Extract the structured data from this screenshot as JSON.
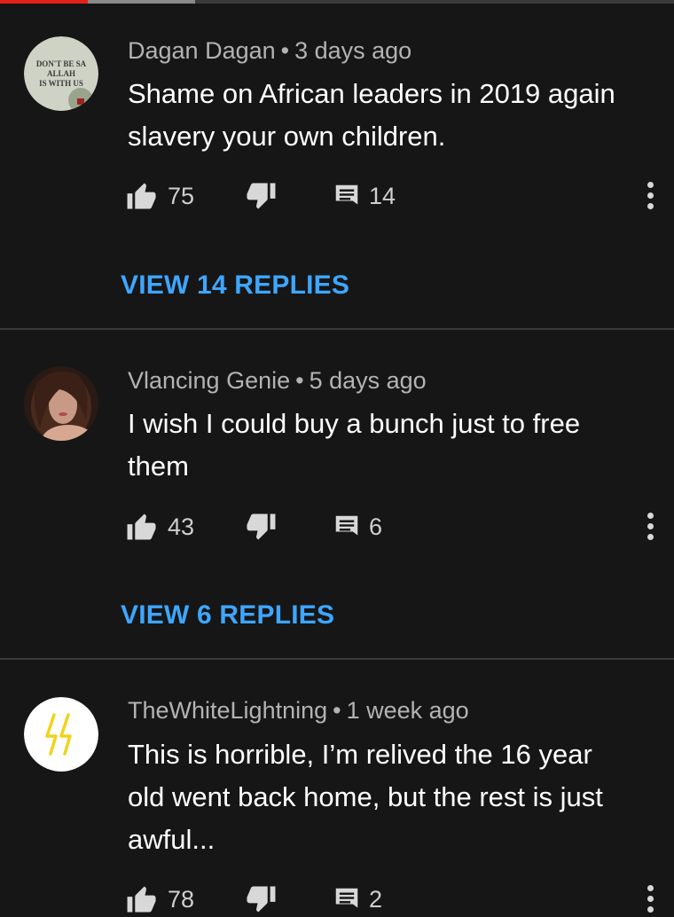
{
  "video_progress": {
    "watched_fraction": 0.13,
    "buffered_fraction": 0.29
  },
  "colors": {
    "accent_link": "#3ea6ff",
    "progress": "#e62117",
    "background": "#161616"
  },
  "comments": [
    {
      "author": "Dagan Dagan",
      "separator": "•",
      "time": "3 days ago",
      "text_lines": [
        "Shame on African leaders in 2019 again",
        "slavery your own children."
      ],
      "likes": "75",
      "replies_count": "14",
      "view_replies": "VIEW 14 REPLIES",
      "avatar": {
        "icon": "text-badge-avatar",
        "lines": [
          "DON'T BE SA",
          "ALLAH",
          "IS WITH US"
        ]
      }
    },
    {
      "author": "Vlancing Genie",
      "separator": "•",
      "time": "5 days ago",
      "text_lines": [
        "I wish I could buy a bunch just to free",
        "them"
      ],
      "likes": "43",
      "replies_count": "6",
      "view_replies": "VIEW 6 REPLIES",
      "avatar": {
        "icon": "portrait-avatar"
      }
    },
    {
      "author": "TheWhiteLightning",
      "separator": "•",
      "time": "1 week ago",
      "text_lines": [
        "This is horrible, I’m relived the 16 year",
        "old went back home, but the rest is just",
        "awful..."
      ],
      "likes": "78",
      "replies_count": "2",
      "avatar": {
        "icon": "lightning-avatar"
      }
    }
  ]
}
